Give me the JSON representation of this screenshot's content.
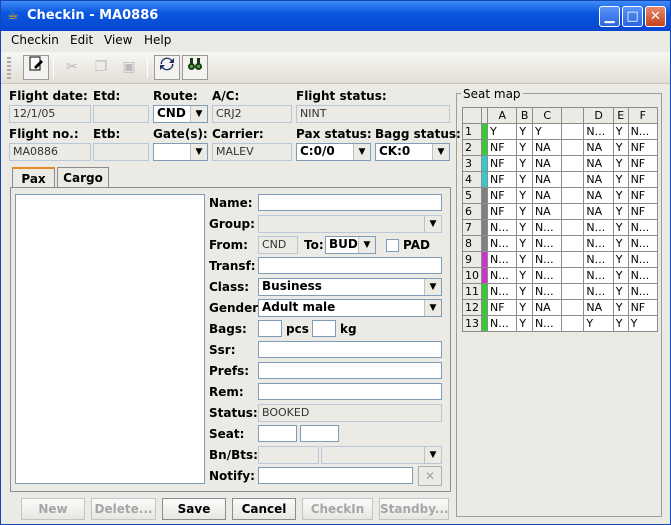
{
  "window": {
    "title": "Checkin - MA0886"
  },
  "colors": {
    "titlebar": "#0a56e0",
    "tab_accent": "#e68b2c"
  },
  "menu": [
    {
      "label": "Checkin"
    },
    {
      "label": "Edit"
    },
    {
      "label": "View"
    },
    {
      "label": "Help"
    }
  ],
  "toolbar": {
    "icons": [
      "edit-document-icon",
      "cut-icon",
      "copy-icon",
      "paste-icon",
      "refresh-icon",
      "search-binoculars-icon"
    ]
  },
  "flight": {
    "date_label": "Flight date:",
    "date_value": "12/1/05",
    "etd_label": "Etd:",
    "etd_value": "",
    "route_label": "Route:",
    "route_value": "CND",
    "ac_label": "A/C:",
    "ac_value": "CRJ2",
    "status_label": "Flight status:",
    "status_value": "NINT",
    "no_label": "Flight no.:",
    "no_value": "MA0886",
    "etb_label": "Etb:",
    "etb_value": "",
    "gates_label": "Gate(s):",
    "gates_value": "",
    "carrier_label": "Carrier:",
    "carrier_value": "MALEV",
    "pax_status_label": "Pax status:",
    "pax_status_value": "C:0/0",
    "bagg_status_label": "Bagg status:",
    "bagg_status_value": "CK:0"
  },
  "tabs": [
    {
      "label": "Pax"
    },
    {
      "label": "Cargo"
    }
  ],
  "pax": {
    "name_label": "Name:",
    "name_value": "",
    "group_label": "Group:",
    "group_value": "",
    "from_label": "From:",
    "from_value": "CND",
    "to_label": "To:",
    "to_value": "BUD",
    "pad_label": "PAD",
    "transf_label": "Transf:",
    "transf_value": "",
    "class_label": "Class:",
    "class_value": "Business",
    "gender_label": "Gender",
    "gender_value": "Adult male",
    "bags_label": "Bags:",
    "bags_value": "",
    "pcs_label": "pcs",
    "kg_value": "",
    "kg_label": "kg",
    "ssr_label": "Ssr:",
    "ssr_value": "",
    "prefs_label": "Prefs:",
    "prefs_value": "",
    "rem_label": "Rem:",
    "rem_value": "",
    "status_label": "Status:",
    "status_value": "BOOKED",
    "seat_label": "Seat:",
    "seat_value1": "",
    "seat_value2": "",
    "bnbts_label": "Bn/Bts:",
    "bnbts_value": "",
    "bnbts_combo": "",
    "notify_label": "Notify:",
    "notify_value": ""
  },
  "buttons": {
    "new": "New",
    "delete": "Delete...",
    "save": "Save",
    "cancel": "Cancel",
    "checkin": "CheckIn",
    "standby": "Standby..."
  },
  "seatmap": {
    "title": "Seat map",
    "columns": [
      "A",
      "B",
      "C",
      "",
      "D",
      "E",
      "F"
    ],
    "rows": [
      {
        "num": "1",
        "mark": "#33cc33",
        "cells": [
          "Y",
          "Y",
          "Y",
          "",
          "N...",
          "Y",
          "N..."
        ]
      },
      {
        "num": "2",
        "mark": "#33cc33",
        "cells": [
          "NF",
          "Y",
          "NA",
          "",
          "NA",
          "Y",
          "NF"
        ]
      },
      {
        "num": "3",
        "mark": "#33cccc",
        "cells": [
          "NF",
          "Y",
          "NA",
          "",
          "NA",
          "Y",
          "NF"
        ]
      },
      {
        "num": "4",
        "mark": "#33cccc",
        "cells": [
          "NF",
          "Y",
          "NA",
          "",
          "NA",
          "Y",
          "NF"
        ]
      },
      {
        "num": "5",
        "mark": "#808080",
        "cells": [
          "NF",
          "Y",
          "NA",
          "",
          "NA",
          "Y",
          "NF"
        ]
      },
      {
        "num": "6",
        "mark": "#808080",
        "cells": [
          "NF",
          "Y",
          "NA",
          "",
          "NA",
          "Y",
          "NF"
        ]
      },
      {
        "num": "7",
        "mark": "#808080",
        "cells": [
          "N...",
          "Y",
          "N...",
          "",
          "N...",
          "Y",
          "N..."
        ]
      },
      {
        "num": "8",
        "mark": "#808080",
        "cells": [
          "N...",
          "Y",
          "N...",
          "",
          "N...",
          "Y",
          "N..."
        ]
      },
      {
        "num": "9",
        "mark": "#cc33cc",
        "cells": [
          "N...",
          "Y",
          "N...",
          "",
          "N...",
          "Y",
          "N..."
        ]
      },
      {
        "num": "10",
        "mark": "#cc33cc",
        "cells": [
          "N...",
          "Y",
          "N...",
          "",
          "N...",
          "Y",
          "N..."
        ]
      },
      {
        "num": "11",
        "mark": "#33cc33",
        "cells": [
          "N...",
          "Y",
          "N...",
          "",
          "N...",
          "Y",
          "N..."
        ]
      },
      {
        "num": "12",
        "mark": "#33cc33",
        "cells": [
          "NF",
          "Y",
          "NA",
          "",
          "NA",
          "Y",
          "NF"
        ]
      },
      {
        "num": "13",
        "mark": "#33cc33",
        "cells": [
          "N...",
          "Y",
          "N...",
          "",
          "Y",
          "Y",
          "Y"
        ]
      }
    ]
  }
}
